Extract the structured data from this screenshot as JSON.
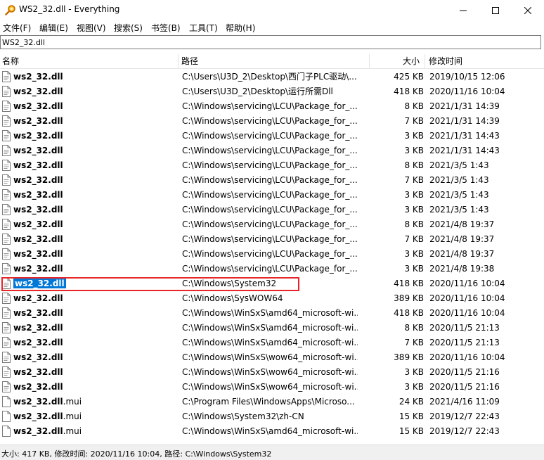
{
  "window": {
    "title": "WS2_32.dll - Everything",
    "icon": "magnifier-icon"
  },
  "menu": [
    "文件(F)",
    "编辑(E)",
    "视图(V)",
    "搜索(S)",
    "书签(B)",
    "工具(T)",
    "帮助(H)"
  ],
  "search": {
    "value": "WS2_32.dll"
  },
  "columns": {
    "name": "名称",
    "path": "路径",
    "size": "大小",
    "modified": "修改时间"
  },
  "rows": [
    {
      "name": "ws2_32.dll",
      "ext": "",
      "path": "C:\\Users\\U3D_2\\Desktop\\西门子PLC驱动\\...",
      "size": "425 KB",
      "modified": "2019/10/15 12:06"
    },
    {
      "name": "ws2_32.dll",
      "ext": "",
      "path": "C:\\Users\\U3D_2\\Desktop\\运行所需Dll",
      "size": "418 KB",
      "modified": "2020/11/16 10:04"
    },
    {
      "name": "ws2_32.dll",
      "ext": "",
      "path": "C:\\Windows\\servicing\\LCU\\Package_for_...",
      "size": "8 KB",
      "modified": "2021/1/31 14:39"
    },
    {
      "name": "ws2_32.dll",
      "ext": "",
      "path": "C:\\Windows\\servicing\\LCU\\Package_for_...",
      "size": "7 KB",
      "modified": "2021/1/31 14:39"
    },
    {
      "name": "ws2_32.dll",
      "ext": "",
      "path": "C:\\Windows\\servicing\\LCU\\Package_for_...",
      "size": "3 KB",
      "modified": "2021/1/31 14:43"
    },
    {
      "name": "ws2_32.dll",
      "ext": "",
      "path": "C:\\Windows\\servicing\\LCU\\Package_for_...",
      "size": "3 KB",
      "modified": "2021/1/31 14:43"
    },
    {
      "name": "ws2_32.dll",
      "ext": "",
      "path": "C:\\Windows\\servicing\\LCU\\Package_for_...",
      "size": "8 KB",
      "modified": "2021/3/5 1:43"
    },
    {
      "name": "ws2_32.dll",
      "ext": "",
      "path": "C:\\Windows\\servicing\\LCU\\Package_for_...",
      "size": "7 KB",
      "modified": "2021/3/5 1:43"
    },
    {
      "name": "ws2_32.dll",
      "ext": "",
      "path": "C:\\Windows\\servicing\\LCU\\Package_for_...",
      "size": "3 KB",
      "modified": "2021/3/5 1:43"
    },
    {
      "name": "ws2_32.dll",
      "ext": "",
      "path": "C:\\Windows\\servicing\\LCU\\Package_for_...",
      "size": "3 KB",
      "modified": "2021/3/5 1:43"
    },
    {
      "name": "ws2_32.dll",
      "ext": "",
      "path": "C:\\Windows\\servicing\\LCU\\Package_for_...",
      "size": "8 KB",
      "modified": "2021/4/8 19:37"
    },
    {
      "name": "ws2_32.dll",
      "ext": "",
      "path": "C:\\Windows\\servicing\\LCU\\Package_for_...",
      "size": "7 KB",
      "modified": "2021/4/8 19:37"
    },
    {
      "name": "ws2_32.dll",
      "ext": "",
      "path": "C:\\Windows\\servicing\\LCU\\Package_for_...",
      "size": "3 KB",
      "modified": "2021/4/8 19:37"
    },
    {
      "name": "ws2_32.dll",
      "ext": "",
      "path": "C:\\Windows\\servicing\\LCU\\Package_for_...",
      "size": "3 KB",
      "modified": "2021/4/8 19:38"
    },
    {
      "name": "ws2_32.dll",
      "ext": "",
      "path": "C:\\Windows\\System32",
      "size": "418 KB",
      "modified": "2020/11/16 10:04",
      "selected": true
    },
    {
      "name": "ws2_32.dll",
      "ext": "",
      "path": "C:\\Windows\\SysWOW64",
      "size": "389 KB",
      "modified": "2020/11/16 10:04"
    },
    {
      "name": "ws2_32.dll",
      "ext": "",
      "path": "C:\\Windows\\WinSxS\\amd64_microsoft-wi...",
      "size": "418 KB",
      "modified": "2020/11/16 10:04"
    },
    {
      "name": "ws2_32.dll",
      "ext": "",
      "path": "C:\\Windows\\WinSxS\\amd64_microsoft-wi...",
      "size": "8 KB",
      "modified": "2020/11/5 21:13"
    },
    {
      "name": "ws2_32.dll",
      "ext": "",
      "path": "C:\\Windows\\WinSxS\\amd64_microsoft-wi...",
      "size": "7 KB",
      "modified": "2020/11/5 21:13"
    },
    {
      "name": "ws2_32.dll",
      "ext": "",
      "path": "C:\\Windows\\WinSxS\\wow64_microsoft-wi...",
      "size": "389 KB",
      "modified": "2020/11/16 10:04"
    },
    {
      "name": "ws2_32.dll",
      "ext": "",
      "path": "C:\\Windows\\WinSxS\\wow64_microsoft-wi...",
      "size": "3 KB",
      "modified": "2020/11/5 21:16"
    },
    {
      "name": "ws2_32.dll",
      "ext": "",
      "path": "C:\\Windows\\WinSxS\\wow64_microsoft-wi...",
      "size": "3 KB",
      "modified": "2020/11/5 21:16"
    },
    {
      "name": "ws2_32.dll",
      "ext": ".mui",
      "path": "C:\\Program Files\\WindowsApps\\Microso...",
      "size": "24 KB",
      "modified": "2021/4/16 11:09"
    },
    {
      "name": "ws2_32.dll",
      "ext": ".mui",
      "path": "C:\\Windows\\System32\\zh-CN",
      "size": "15 KB",
      "modified": "2019/12/7 22:43"
    },
    {
      "name": "ws2_32.dll",
      "ext": ".mui",
      "path": "C:\\Windows\\WinSxS\\amd64_microsoft-wi...",
      "size": "15 KB",
      "modified": "2019/12/7 22:43"
    }
  ],
  "status": {
    "text": "大小: 417 KB, 修改时间: 2020/11/16 10:04, 路径: C:\\Windows\\System32"
  },
  "colors": {
    "selection": "#0078d7",
    "highlight_box": "#e8262a"
  }
}
